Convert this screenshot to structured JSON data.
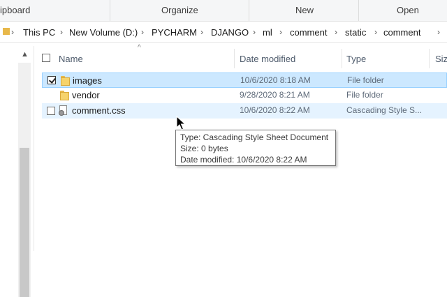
{
  "ribbon": {
    "groups": [
      "ipboard",
      "Organize",
      "New",
      "Open"
    ]
  },
  "address": {
    "crumbs": [
      "This PC",
      "New Volume (D:)",
      "PYCHARM",
      "DJANGO",
      "ml",
      "comment",
      "static",
      "comment"
    ]
  },
  "columns": {
    "name": "Name",
    "date": "Date modified",
    "type": "Type",
    "size": "Size"
  },
  "files": [
    {
      "name": "images",
      "date": "10/6/2020 8:18 AM",
      "type": "File folder",
      "icon": "folder-icon",
      "checked": true,
      "state": "selected"
    },
    {
      "name": "vendor",
      "date": "9/28/2020 8:21 AM",
      "type": "File folder",
      "icon": "folder-icon",
      "checked": false,
      "state": "normal"
    },
    {
      "name": "comment.css",
      "date": "10/6/2020 8:22 AM",
      "type": "Cascading Style S...",
      "icon": "css-file-icon",
      "checked": false,
      "state": "hover"
    }
  ],
  "tooltip": {
    "type_line": "Type: Cascading Style Sheet Document",
    "size_line": "Size: 0 bytes",
    "date_line": "Date modified: 10/6/2020 8:22 AM"
  },
  "colors": {
    "selected_bg": "#cce8ff",
    "hover_bg": "#e5f3ff",
    "folder": "#f6d36b"
  }
}
